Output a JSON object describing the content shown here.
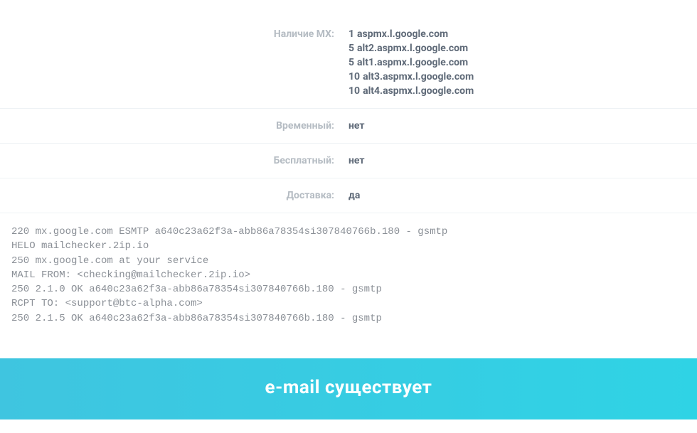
{
  "rows": {
    "mx": {
      "label": "Наличие MX:",
      "entries": [
        {
          "priority": "1",
          "host": "aspmx.l.google.com"
        },
        {
          "priority": "5",
          "host": "alt2.aspmx.l.google.com"
        },
        {
          "priority": "5",
          "host": "alt1.aspmx.l.google.com"
        },
        {
          "priority": "10",
          "host": "alt3.aspmx.l.google.com"
        },
        {
          "priority": "10",
          "host": "alt4.aspmx.l.google.com"
        }
      ]
    },
    "temporary": {
      "label": "Временный:",
      "value": "нет"
    },
    "free": {
      "label": "Бесплатный:",
      "value": "нет"
    },
    "delivery": {
      "label": "Доставка:",
      "value": "да"
    }
  },
  "smtp_log": "220 mx.google.com ESMTP a640c23a62f3a-abb86a78354si307840766b.180 - gsmtp\nHELO mailchecker.2ip.io\n250 mx.google.com at your service\nMAIL FROM: <checking@mailchecker.2ip.io>\n250 2.1.0 OK a640c23a62f3a-abb86a78354si307840766b.180 - gsmtp\nRCPT TO: <support@btc-alpha.com>\n250 2.1.5 OK a640c23a62f3a-abb86a78354si307840766b.180 - gsmtp",
  "banner": "e-mail существует"
}
